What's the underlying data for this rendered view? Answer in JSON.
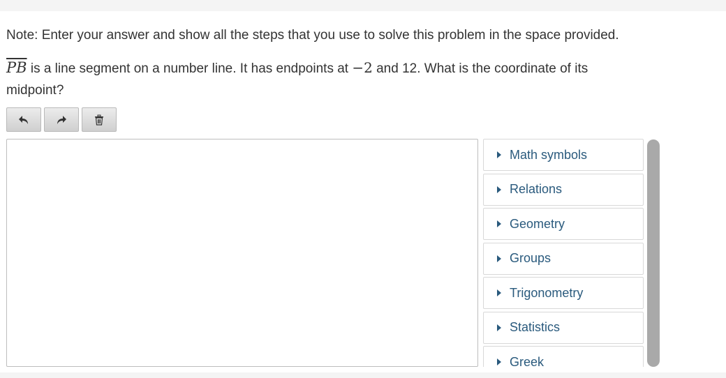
{
  "note": "Note: Enter your answer and show all the steps that you use to solve this problem in the space provided.",
  "question": {
    "segment": "PB",
    "text_part1": " is a line segment on a number line. It has endpoints at ",
    "endpoint_a": "−2",
    "text_part2": " and 12. What is the coordinate of its midpoint?"
  },
  "toolbar": {
    "undo_icon": "undo-icon",
    "redo_icon": "redo-icon",
    "clear_icon": "trash-icon"
  },
  "answer": {
    "value": ""
  },
  "palette": {
    "items": [
      {
        "label": "Math symbols"
      },
      {
        "label": "Relations"
      },
      {
        "label": "Geometry"
      },
      {
        "label": "Groups"
      },
      {
        "label": "Trigonometry"
      },
      {
        "label": "Statistics"
      },
      {
        "label": "Greek"
      }
    ]
  },
  "colors": {
    "link": "#2a5a7d",
    "scrollbar": "#a9a9a9",
    "button": "#dcdcdc"
  }
}
